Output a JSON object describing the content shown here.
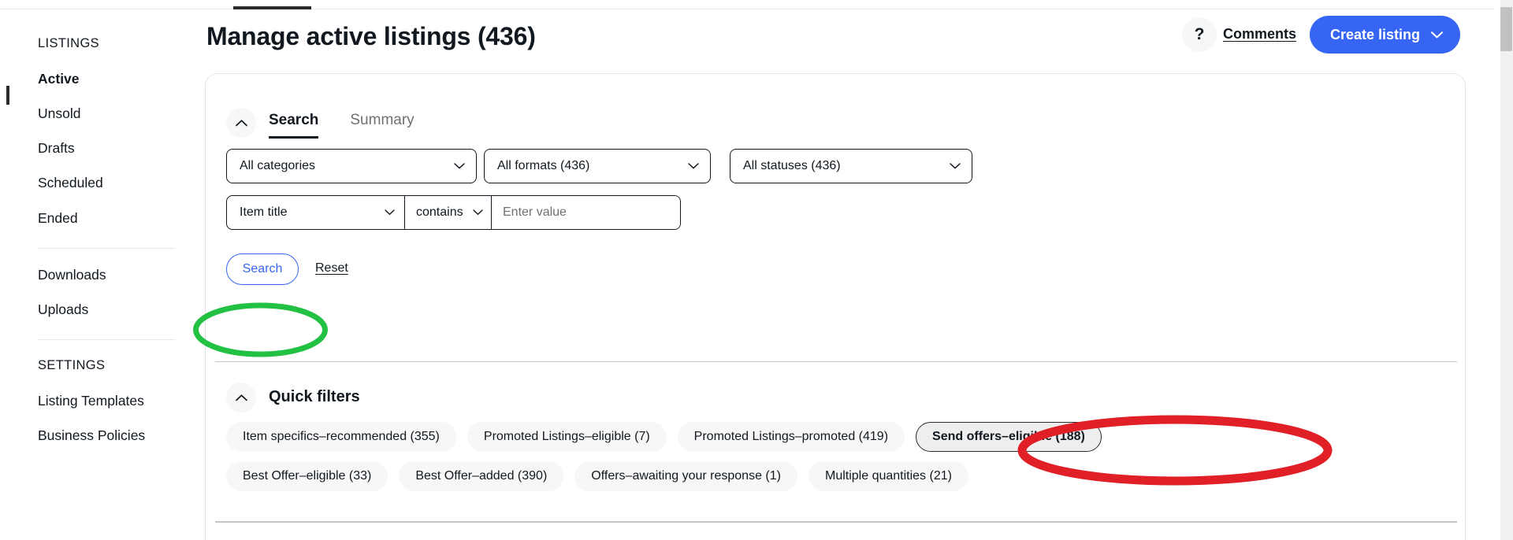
{
  "colors": {
    "accent_blue": "#3665f3",
    "chip_bg": "#f7f7f7",
    "chip_selected_bg": "#eeeeee",
    "text": "#111820",
    "muted": "#707070",
    "annotation_green": "#22c043",
    "annotation_red": "#e01f26"
  },
  "sidebar": {
    "sections": [
      {
        "label": "LISTINGS"
      },
      {
        "label": "SETTINGS"
      }
    ],
    "listings_items": [
      {
        "label": "Active",
        "active": true
      },
      {
        "label": "Unsold",
        "active": false
      },
      {
        "label": "Drafts",
        "active": false
      },
      {
        "label": "Scheduled",
        "active": false
      },
      {
        "label": "Ended",
        "active": false
      }
    ],
    "tools_items": [
      {
        "label": "Downloads"
      },
      {
        "label": "Uploads"
      }
    ],
    "settings_items": [
      {
        "label": "Listing Templates"
      },
      {
        "label": "Business Policies"
      }
    ]
  },
  "header": {
    "title": "Manage active listings (436)",
    "help_icon": "question-mark-icon",
    "comments_label": "Comments",
    "create_listing_label": "Create listing",
    "create_listing_chevron": "chevron-down-icon"
  },
  "card": {
    "search_panel": {
      "collapse_icon": "chevron-up-icon",
      "tabs": [
        {
          "label": "Search",
          "active": true
        },
        {
          "label": "Summary",
          "active": false
        }
      ],
      "filters": {
        "categories": {
          "value": "All categories",
          "chevron": "chevron-down-icon"
        },
        "formats": {
          "value": "All formats (436)",
          "chevron": "chevron-down-icon"
        },
        "statuses": {
          "value": "All statuses (436)",
          "chevron": "chevron-down-icon"
        }
      },
      "criteria": {
        "field": {
          "value": "Item title",
          "chevron": "chevron-down-icon"
        },
        "operator": {
          "value": "contains",
          "chevron": "chevron-down-icon"
        },
        "value_input": {
          "value": "",
          "placeholder": "Enter value"
        }
      },
      "search_button": "Search",
      "reset_link": "Reset"
    },
    "quick_filters": {
      "collapse_icon": "chevron-up-icon",
      "title": "Quick filters",
      "row1": [
        {
          "label": "Item specifics–recommended (355)",
          "selected": false
        },
        {
          "label": "Promoted Listings–eligible (7)",
          "selected": false
        },
        {
          "label": "Promoted Listings–promoted (419)",
          "selected": false
        },
        {
          "label": "Send offers–eligible (188)",
          "selected": true
        }
      ],
      "row2": [
        {
          "label": "Best Offer–eligible (33)",
          "selected": false
        },
        {
          "label": "Best Offer–added (390)",
          "selected": false
        },
        {
          "label": "Offers–awaiting your response (1)",
          "selected": false
        },
        {
          "label": "Multiple quantities (21)",
          "selected": false
        }
      ]
    }
  },
  "annotations": [
    {
      "name": "green-ellipse-quick-filters",
      "shape": "ellipse",
      "color": "#22c043"
    },
    {
      "name": "red-ellipse-send-offers",
      "shape": "ellipse",
      "color": "#e01f26"
    }
  ],
  "scrollbar": {
    "orientation": "vertical"
  }
}
